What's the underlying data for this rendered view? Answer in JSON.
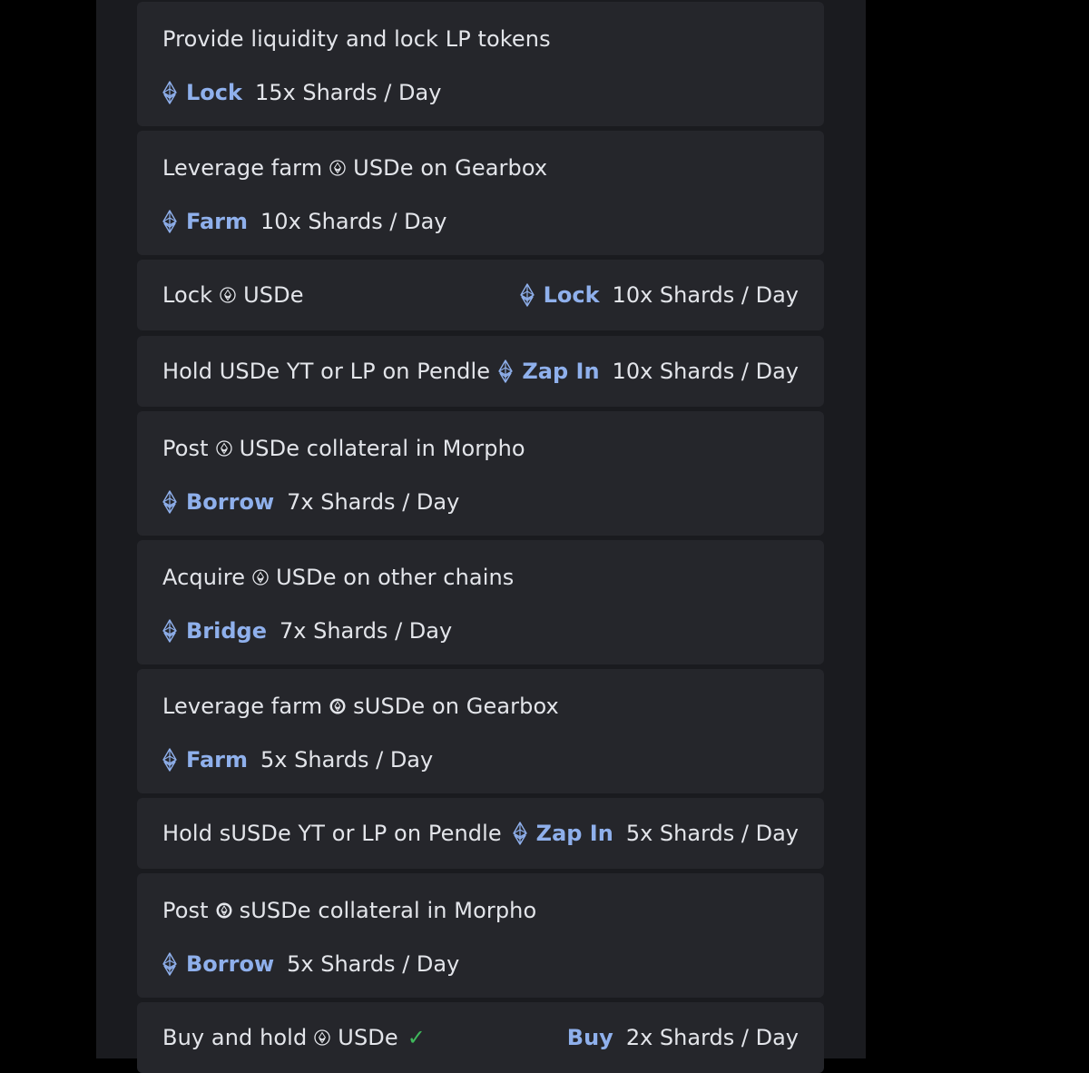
{
  "colors": {
    "background": "#000000",
    "panel": "#1a1b1f",
    "card": "#25262b",
    "accent": "#8fb0ec",
    "text": "#e3e5ea",
    "check": "#3fb85c"
  },
  "icons": {
    "eth": "ethereum-diamond-icon",
    "usde": "usde-coin-icon",
    "susde": "susde-coin-icon",
    "check": "checkmark-icon"
  },
  "tasks": [
    {
      "pre": "Provide liquidity and lock LP tokens",
      "coin": "",
      "post": "",
      "action": "Lock",
      "reward": "15x Shards / Day"
    },
    {
      "pre": "Leverage farm",
      "coin": "usde",
      "post": "USDe on Gearbox",
      "action": "Farm",
      "reward": "10x Shards / Day"
    },
    {
      "pre": "Lock",
      "coin": "usde",
      "post": "USDe",
      "action": "Lock",
      "reward": "10x Shards / Day"
    },
    {
      "pre": "Hold USDe YT or LP on Pendle",
      "coin": "",
      "post": "",
      "action": "Zap In",
      "reward": "10x Shards / Day"
    },
    {
      "pre": "Post",
      "coin": "usde",
      "post": "USDe collateral in Morpho",
      "action": "Borrow",
      "reward": "7x Shards / Day"
    },
    {
      "pre": "Acquire",
      "coin": "usde",
      "post": "USDe on other chains",
      "action": "Bridge",
      "reward": "7x Shards / Day"
    },
    {
      "pre": "Leverage farm",
      "coin": "susde",
      "post": "sUSDe on Gearbox",
      "action": "Farm",
      "reward": "5x Shards / Day"
    },
    {
      "pre": "Hold sUSDe YT or LP on Pendle",
      "coin": "",
      "post": "",
      "action": "Zap In",
      "reward": "5x Shards / Day"
    },
    {
      "pre": "Post",
      "coin": "susde",
      "post": "sUSDe collateral in Morpho",
      "action": "Borrow",
      "reward": "5x Shards / Day"
    },
    {
      "pre": "Buy and hold",
      "coin": "usde",
      "post": "USDe",
      "check": "✓",
      "action": "Buy",
      "reward": "2x Shards / Day"
    }
  ]
}
